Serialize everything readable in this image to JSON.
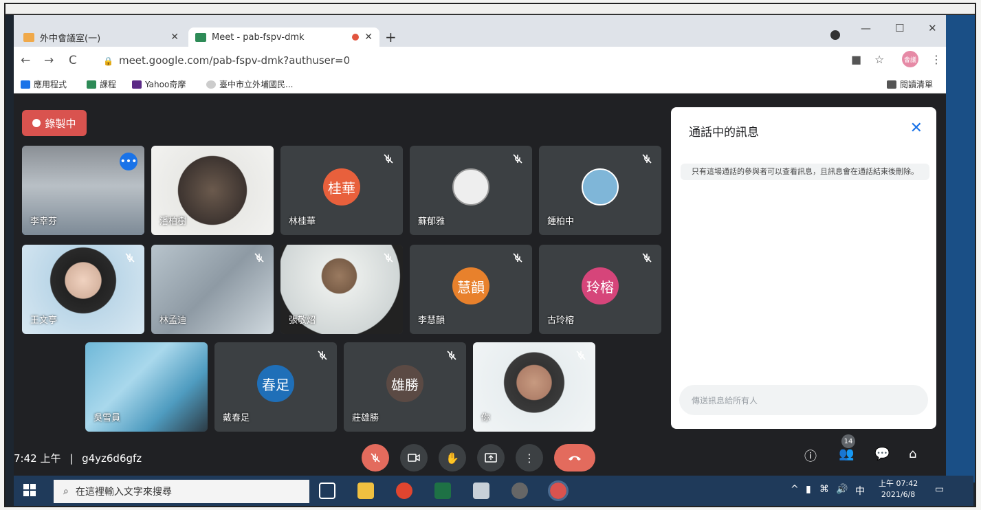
{
  "browser": {
    "tabs": [
      {
        "title": "外中會議室(一)",
        "active": false
      },
      {
        "title": "Meet - pab-fspv-dmk",
        "active": true
      }
    ],
    "new_tab": "+",
    "url": "meet.google.com/pab-fspv-dmk?authuser=0",
    "bookmarks": [
      "應用程式",
      "課程",
      "Yahoo奇摩",
      "臺中市立外埔國民..."
    ],
    "reading_list": "閱讀清單",
    "avatar_text": "會議"
  },
  "meet": {
    "recording_label": "錄製中",
    "participants": [
      {
        "name": "李幸芬",
        "type": "photo"
      },
      {
        "name": "潘柏樹",
        "type": "photo"
      },
      {
        "name": "林桂華",
        "type": "avatar",
        "initials": "桂華",
        "color": "#e8603c"
      },
      {
        "name": "蘇郁雅",
        "type": "image"
      },
      {
        "name": "鍾柏中",
        "type": "image"
      },
      {
        "name": "王文亭",
        "type": "photo"
      },
      {
        "name": "林孟迪",
        "type": "photo"
      },
      {
        "name": "張敬炤",
        "type": "photo"
      },
      {
        "name": "李慧韻",
        "type": "avatar",
        "initials": "慧韻",
        "color": "#e8812c"
      },
      {
        "name": "古玲榕",
        "type": "avatar",
        "initials": "玲榕",
        "color": "#d6457a"
      },
      {
        "name": "吳雪員",
        "type": "photo"
      },
      {
        "name": "戴春足",
        "type": "avatar",
        "initials": "春足",
        "color": "#1f6fb8"
      },
      {
        "name": "莊雄勝",
        "type": "avatar",
        "initials": "雄勝",
        "color": "#5b4a44"
      },
      {
        "name": "你",
        "type": "photo"
      }
    ],
    "chat": {
      "title": "通話中的訊息",
      "note": "只有這場通話的參與者可以查看訊息，且訊息會在通話結束後刪除。",
      "input_placeholder": "傳送訊息給所有人"
    },
    "time": "7:42 上午",
    "separator": "|",
    "meeting_code": "g4yz6d6gfz",
    "people_count": "14"
  },
  "taskbar": {
    "search_placeholder": "在這裡輸入文字來搜尋",
    "ime": "中",
    "clock_time": "上午 07:42",
    "clock_date": "2021/6/8"
  }
}
